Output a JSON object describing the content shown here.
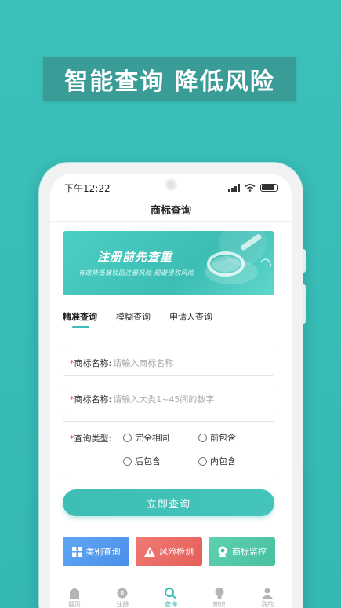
{
  "hero": {
    "text": "智能查询 降低风险"
  },
  "status_bar": {
    "time": "下午12:22"
  },
  "nav": {
    "title": "商标查询"
  },
  "promo": {
    "title": "注册前先查重",
    "subtitle": "有效降低被驳回注册风险  规避侵权风险"
  },
  "tabs": [
    {
      "label": "精准查询"
    },
    {
      "label": "模糊查询"
    },
    {
      "label": "申请人查询"
    }
  ],
  "form": {
    "required_mark": "*",
    "name_label": "商标名称:",
    "name_placeholder": "请输入商标名称",
    "class_label": "商标名称:",
    "class_placeholder": "请输入大类1~45间的数字",
    "type_label": "查询类型:",
    "options": [
      "完全相同",
      "前包含",
      "后包含",
      "内包含"
    ]
  },
  "search_button": {
    "label": "立即查询"
  },
  "quick_actions": [
    {
      "label": "类别查询",
      "icon": "grid-icon"
    },
    {
      "label": "风险检测",
      "icon": "warning-icon"
    },
    {
      "label": "商标监控",
      "icon": "monitor-icon"
    }
  ],
  "bottom_nav": [
    {
      "label": "首页",
      "icon": "home-icon"
    },
    {
      "label": "注册",
      "icon": "registered-icon"
    },
    {
      "label": "查询",
      "icon": "search-icon"
    },
    {
      "label": "知识",
      "icon": "bulb-icon"
    },
    {
      "label": "我的",
      "icon": "user-icon"
    }
  ],
  "colors": {
    "accent": "#3dbdb4",
    "background": "#3cc0ba",
    "blue": "#4a8fe8",
    "red": "#e55e58",
    "green": "#47c1a1"
  }
}
